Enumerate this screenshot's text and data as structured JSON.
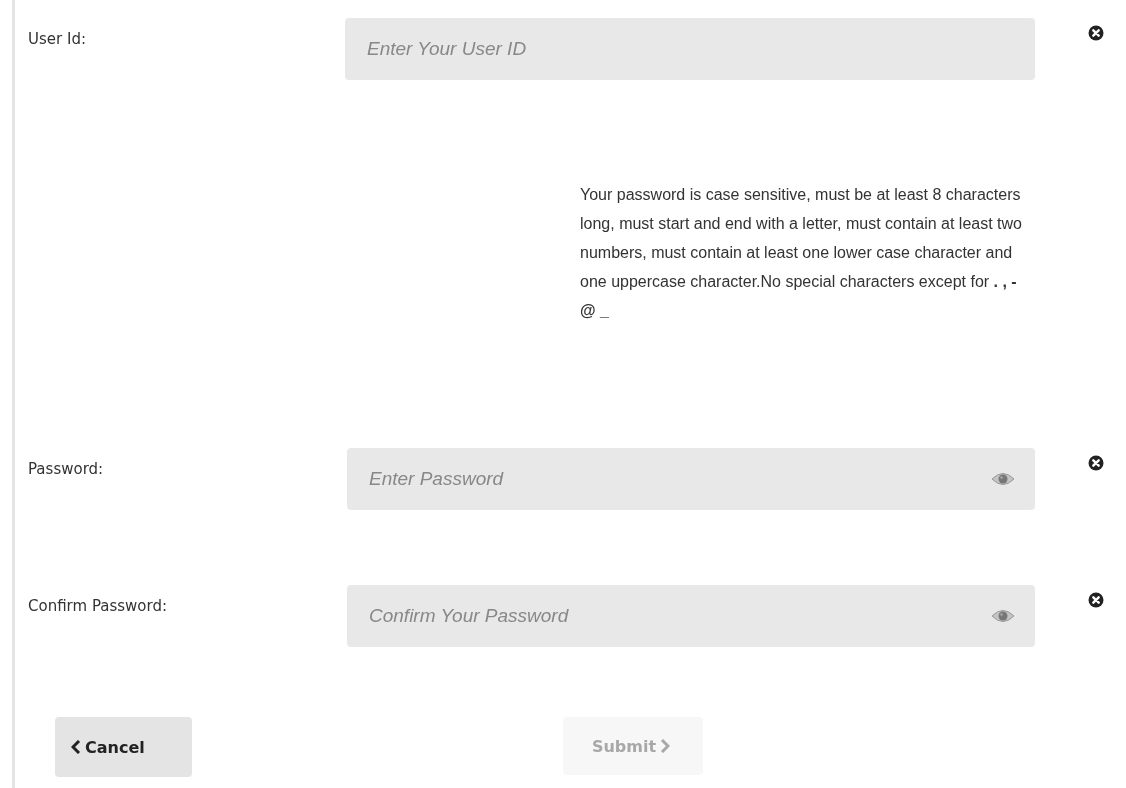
{
  "fields": [
    {
      "kind": "text",
      "label": "User Id:",
      "placeholder": "Enter Your User ID",
      "reveal_toggle": false
    },
    {
      "kind": "help",
      "text": "Your password is case sensitive, must be at least 8 characters long, must start and end with a letter, must contain at least two numbers, must contain at least one lower case character and one uppercase character.No special characters except for **. , - @ _**"
    },
    {
      "kind": "password",
      "label": "Password:",
      "placeholder": "Enter Password",
      "reveal_toggle": true
    },
    {
      "kind": "password",
      "label": "Confirm Password:",
      "placeholder": "Confirm Your Password",
      "reveal_toggle": true
    }
  ],
  "buttons": [
    {
      "kind": "back",
      "label": "Cancel",
      "disabled": false
    },
    {
      "kind": "forward",
      "label": "Submit",
      "disabled": true
    }
  ]
}
